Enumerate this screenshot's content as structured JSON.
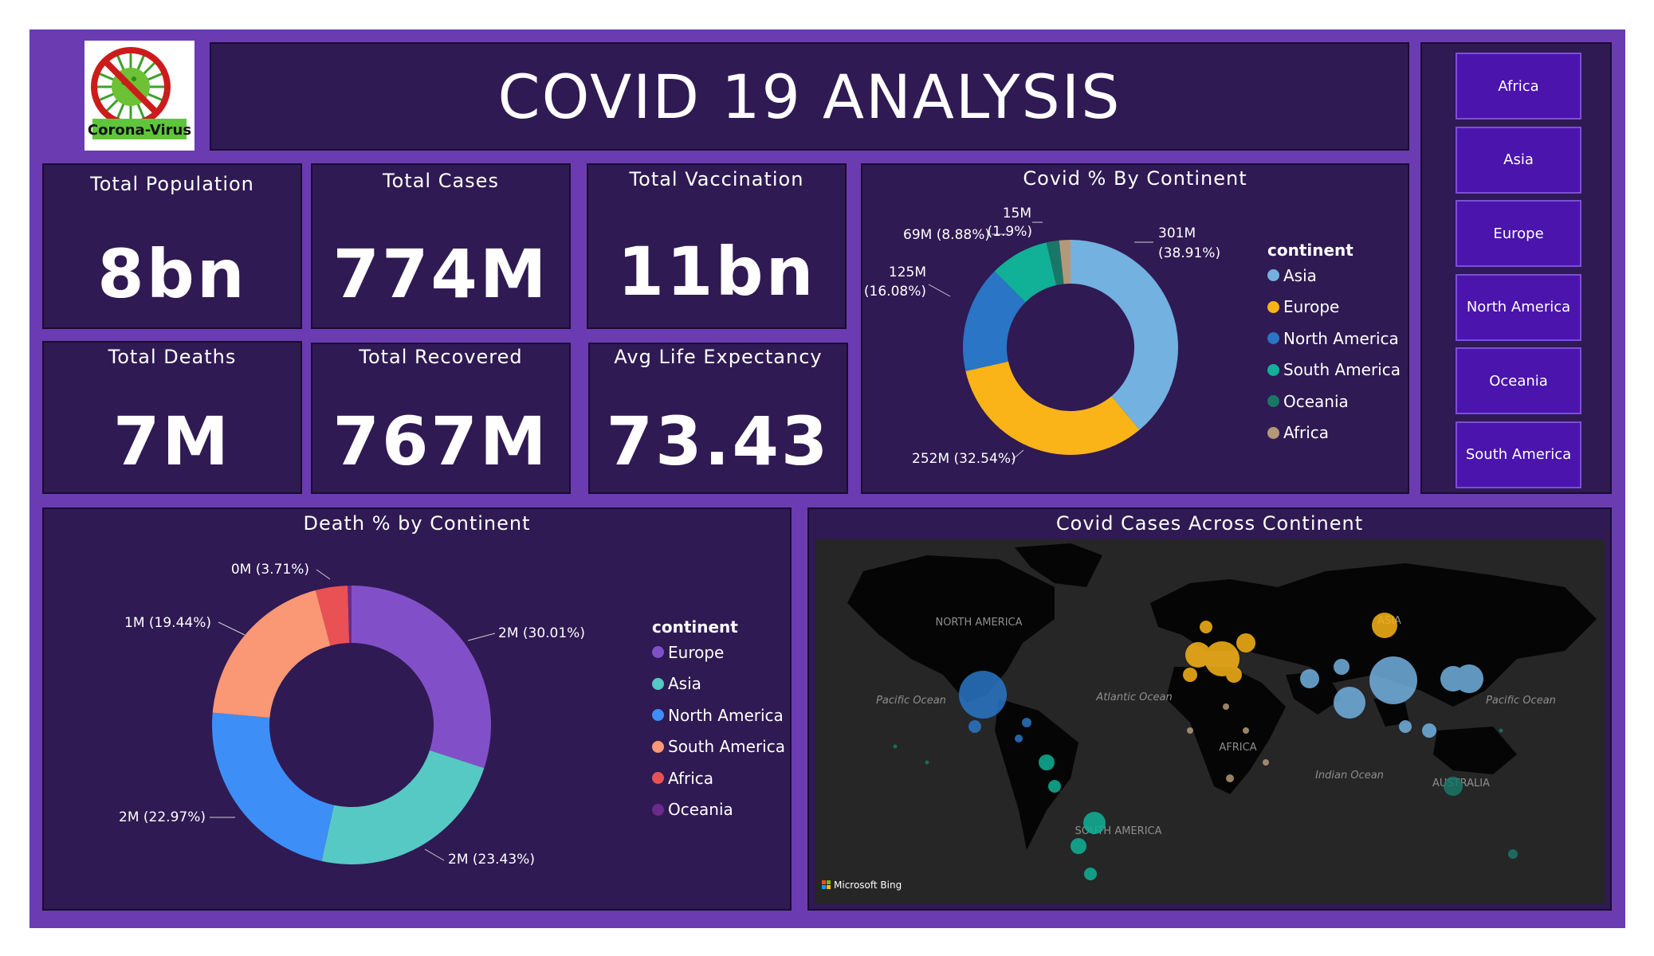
{
  "header": {
    "title": "COVID 19 ANALYSIS",
    "logo_text": "Corona-Virus"
  },
  "kpis": {
    "total_population": {
      "label": "Total Population",
      "value": "8bn"
    },
    "total_cases": {
      "label": "Total Cases",
      "value": "774M"
    },
    "total_vaccination": {
      "label": "Total Vaccination",
      "value": "11bn"
    },
    "total_deaths": {
      "label": "Total Deaths",
      "value": "7M"
    },
    "total_recovered": {
      "label": "Total Recovered",
      "value": "767M"
    },
    "avg_life_expectancy": {
      "label": "Avg Life Expectancy",
      "value": "73.43"
    }
  },
  "slicer": {
    "options": [
      "Africa",
      "Asia",
      "Europe",
      "North America",
      "Oceania",
      "South America"
    ]
  },
  "map": {
    "title": "Covid Cases Across Continent",
    "attribution": "Microsoft Bing",
    "labels": [
      "NORTH AMERICA",
      "SOUTH AMERICA",
      "AFRICA",
      "ASIA",
      "AUSTRALIA",
      "Pacific Ocean",
      "Atlantic Ocean",
      "Indian Ocean"
    ]
  },
  "chart_data": [
    {
      "type": "pie",
      "title": "Covid % By Continent",
      "legend_title": "continent",
      "legend_position": "right",
      "slices": [
        {
          "name": "Asia",
          "value_label": "301M",
          "percent": 38.91,
          "color": "#72b1e0"
        },
        {
          "name": "Europe",
          "value_label": "252M",
          "percent": 32.54,
          "color": "#fab417"
        },
        {
          "name": "North America",
          "value_label": "125M",
          "percent": 16.08,
          "color": "#2a75c5"
        },
        {
          "name": "South America",
          "value_label": "69M",
          "percent": 8.88,
          "color": "#10b197"
        },
        {
          "name": "Oceania",
          "value_label": "15M",
          "percent": 1.9,
          "color": "#1a7767"
        },
        {
          "name": "Africa",
          "value_label": "",
          "percent": 1.69,
          "color": "#b3997a"
        }
      ],
      "data_labels": [
        "301M",
        "(38.91%)",
        "252M (32.54%)",
        "125M",
        "(16.08%)",
        "69M (8.88%)",
        "15M",
        "(1.9%)"
      ]
    },
    {
      "type": "pie",
      "title": "Death % by Continent",
      "legend_title": "continent",
      "legend_position": "right",
      "slices": [
        {
          "name": "Europe",
          "value_label": "2M",
          "percent": 30.01,
          "color": "#8150c8"
        },
        {
          "name": "Asia",
          "value_label": "2M",
          "percent": 23.43,
          "color": "#56c9c4"
        },
        {
          "name": "North America",
          "value_label": "2M",
          "percent": 22.97,
          "color": "#3e8ef7"
        },
        {
          "name": "South America",
          "value_label": "1M",
          "percent": 19.44,
          "color": "#fa9774"
        },
        {
          "name": "Africa",
          "value_label": "0M",
          "percent": 3.71,
          "color": "#e95155"
        },
        {
          "name": "Oceania",
          "value_label": "",
          "percent": 0.44,
          "color": "#6b2a8c"
        }
      ],
      "data_labels": [
        "2M (30.01%)",
        "2M (23.43%)",
        "2M (22.97%)",
        "1M (19.44%)",
        "0M (3.71%)"
      ]
    }
  ]
}
